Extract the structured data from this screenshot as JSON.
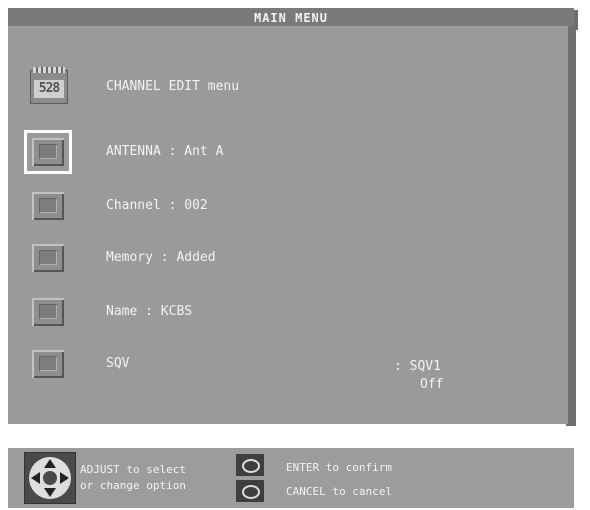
{
  "title": "MAIN MENU",
  "channel_edit": {
    "icon_digits": "528",
    "title": "CHANNEL EDIT menu"
  },
  "rows": [
    {
      "label": "ANTENNA : Ant A",
      "selected": true
    },
    {
      "label": "Channel : 002"
    },
    {
      "label": "Memory : Added"
    },
    {
      "label": "Name : KCBS"
    },
    {
      "label": "SQV",
      "value": ": SQV1",
      "value2": "Off"
    }
  ],
  "help": {
    "adjust_line1": "ADJUST to select",
    "adjust_line2": "or change option",
    "enter": "ENTER to confirm",
    "cancel": "CANCEL to cancel"
  },
  "colors": {
    "panel": "#9a9a9a",
    "title_bar": "#7a7a7a",
    "text": "#f3f3f3"
  }
}
